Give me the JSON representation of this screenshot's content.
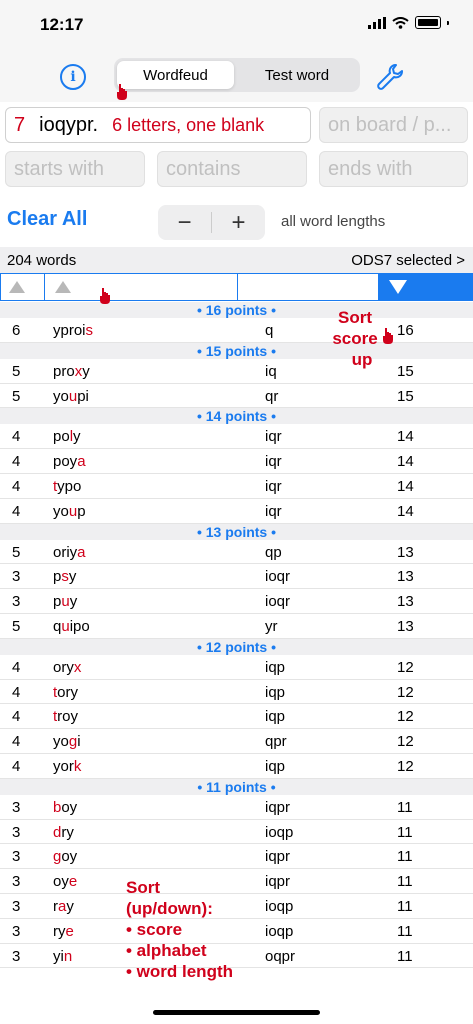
{
  "status_bar": {
    "time": "12:17"
  },
  "segmented": {
    "active": "Wordfeud",
    "inactive": "Test word"
  },
  "letters": {
    "count": "7",
    "value": "ioqypr.",
    "note": "6 letters, one blank"
  },
  "fields": {
    "on_board_placeholder": "on board / p...",
    "starts_placeholder": "starts with",
    "contains_placeholder": "contains",
    "ends_placeholder": "ends with"
  },
  "controls": {
    "clear_all": "Clear All",
    "minus": "−",
    "plus": "+",
    "lengths": "all word lengths"
  },
  "summary": {
    "word_count": "204 words",
    "dictionary": "ODS7 selected >"
  },
  "annotations": {
    "sort_score": [
      "Sort",
      "score",
      "up"
    ],
    "sort_help": [
      "Sort",
      "(up/down):",
      "• score",
      "• alphabet",
      "• word length"
    ]
  },
  "groups": [
    {
      "header": "• 16 points •",
      "rows": [
        {
          "len": "6",
          "pre": "yproi",
          "hl": "s",
          "post": "",
          "rem": "q",
          "score": "16"
        }
      ]
    },
    {
      "header": "• 15 points •",
      "rows": [
        {
          "len": "5",
          "pre": "pro",
          "hl": "x",
          "post": "y",
          "rem": "iq",
          "score": "15"
        },
        {
          "len": "5",
          "pre": "yo",
          "hl": "u",
          "post": "pi",
          "rem": "qr",
          "score": "15"
        }
      ]
    },
    {
      "header": "• 14 points •",
      "rows": [
        {
          "len": "4",
          "pre": "po",
          "hl": "l",
          "post": "y",
          "rem": "iqr",
          "score": "14"
        },
        {
          "len": "4",
          "pre": "poy",
          "hl": "a",
          "post": "",
          "rem": "iqr",
          "score": "14"
        },
        {
          "len": "4",
          "pre": "",
          "hl": "t",
          "post": "ypo",
          "rem": "iqr",
          "score": "14"
        },
        {
          "len": "4",
          "pre": "yo",
          "hl": "u",
          "post": "p",
          "rem": "iqr",
          "score": "14"
        }
      ]
    },
    {
      "header": "• 13 points •",
      "rows": [
        {
          "len": "5",
          "pre": "oriy",
          "hl": "a",
          "post": "",
          "rem": "qp",
          "score": "13"
        },
        {
          "len": "3",
          "pre": "p",
          "hl": "s",
          "post": "y",
          "rem": "ioqr",
          "score": "13"
        },
        {
          "len": "3",
          "pre": "p",
          "hl": "u",
          "post": "y",
          "rem": "ioqr",
          "score": "13"
        },
        {
          "len": "5",
          "pre": "q",
          "hl": "u",
          "post": "ipo",
          "rem": "yr",
          "score": "13"
        }
      ]
    },
    {
      "header": "• 12 points •",
      "rows": [
        {
          "len": "4",
          "pre": "ory",
          "hl": "x",
          "post": "",
          "rem": "iqp",
          "score": "12"
        },
        {
          "len": "4",
          "pre": "",
          "hl": "t",
          "post": "ory",
          "rem": "iqp",
          "score": "12"
        },
        {
          "len": "4",
          "pre": "",
          "hl": "t",
          "post": "roy",
          "rem": "iqp",
          "score": "12"
        },
        {
          "len": "4",
          "pre": "yo",
          "hl": "g",
          "post": "i",
          "rem": "qpr",
          "score": "12"
        },
        {
          "len": "4",
          "pre": "yor",
          "hl": "k",
          "post": "",
          "rem": "iqp",
          "score": "12"
        }
      ]
    },
    {
      "header": "• 11 points •",
      "rows": [
        {
          "len": "3",
          "pre": "",
          "hl": "b",
          "post": "oy",
          "rem": "iqpr",
          "score": "11"
        },
        {
          "len": "3",
          "pre": "",
          "hl": "d",
          "post": "ry",
          "rem": "ioqp",
          "score": "11"
        },
        {
          "len": "3",
          "pre": "",
          "hl": "g",
          "post": "oy",
          "rem": "iqpr",
          "score": "11"
        },
        {
          "len": "3",
          "pre": "oy",
          "hl": "e",
          "post": "",
          "rem": "iqpr",
          "score": "11"
        },
        {
          "len": "3",
          "pre": "r",
          "hl": "a",
          "post": "y",
          "rem": "ioqp",
          "score": "11"
        },
        {
          "len": "3",
          "pre": "ry",
          "hl": "e",
          "post": "",
          "rem": "ioqp",
          "score": "11"
        },
        {
          "len": "3",
          "pre": "yi",
          "hl": "n",
          "post": "",
          "rem": "oqpr",
          "score": "11"
        }
      ]
    }
  ],
  "colors": {
    "accent": "#1a7bef",
    "highlight": "#d0011b"
  }
}
